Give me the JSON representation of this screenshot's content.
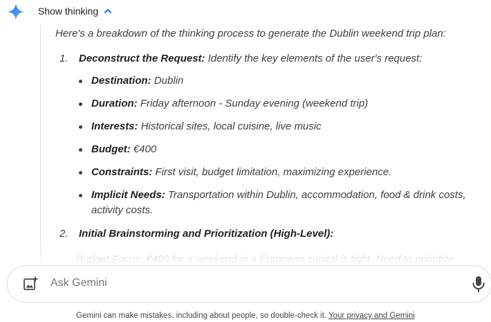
{
  "header": {
    "toggle_label": "Show thinking",
    "logo_icon": "gemini-spark-icon",
    "toggle_icon": "chevron-up-icon"
  },
  "thinking": {
    "intro": "Here's a breakdown of the thinking process to generate the Dublin weekend trip plan:",
    "steps": [
      {
        "number": "1.",
        "title": "Deconstruct the Request:",
        "text": " Identify the key elements of the user's request:",
        "items": [
          {
            "label": "Destination:",
            "text": " Dublin"
          },
          {
            "label": "Duration:",
            "text": " Friday afternoon - Sunday evening (weekend trip)"
          },
          {
            "label": "Interests:",
            "text": " Historical sites, local cuisine, live music"
          },
          {
            "label": "Budget:",
            "text": " €400"
          },
          {
            "label": "Constraints:",
            "text": " First visit, budget limitation, maximizing experience."
          },
          {
            "label": "Implicit Needs:",
            "text": " Transportation within Dublin, accommodation, food & drink costs, activity costs."
          }
        ]
      },
      {
        "number": "2.",
        "title": "Initial Brainstorming and Prioritization (High-Level):",
        "text": ""
      }
    ],
    "faded_line": "Budget Focus: €400 for a weekend in a European capital is tight. Need to prioritize"
  },
  "input": {
    "placeholder": "Ask Gemini",
    "left_icon": "add-image-icon",
    "right_icon": "microphone-icon"
  },
  "footer": {
    "text": "Gemini can make mistakes, including about people, so double-check it. ",
    "link": "Your privacy and Gemini"
  },
  "colors": {
    "spark_blue": "#4285f4",
    "text": "#3c4043",
    "border": "#dadce0"
  }
}
